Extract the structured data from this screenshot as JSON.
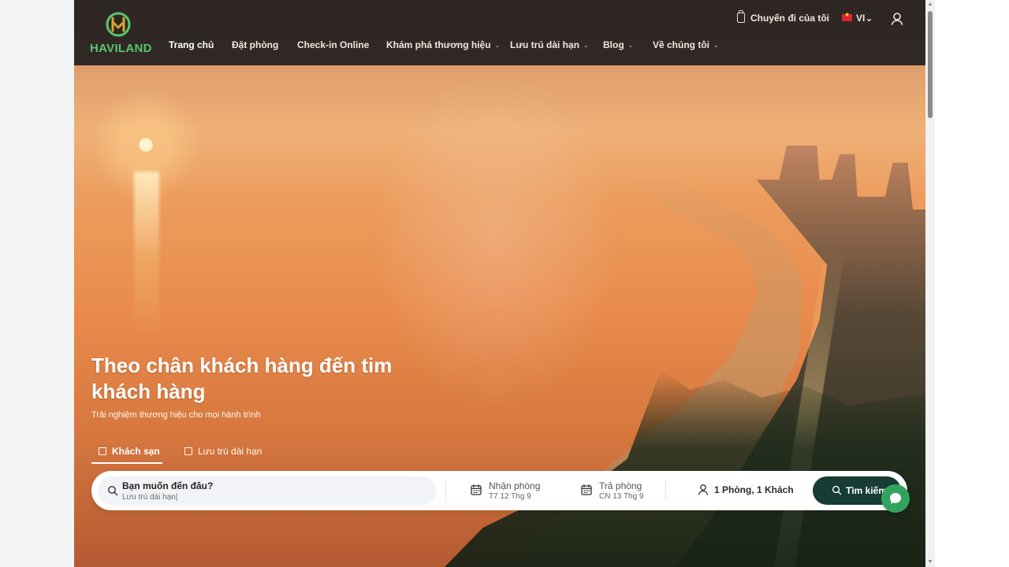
{
  "brand": {
    "name": "HAVILAND",
    "accent": "#58C66F"
  },
  "nav": {
    "items": [
      {
        "label": "Trang chủ"
      },
      {
        "label": "Đặt phòng"
      },
      {
        "label": "Check-in Online"
      },
      {
        "label": "Khám phá thương hiệu"
      },
      {
        "label": "Lưu trú dài hạn"
      },
      {
        "label": "Blog"
      },
      {
        "label": "Về chúng tôi"
      }
    ],
    "trip_label": "Chuyến đi của tôi",
    "language": "VI"
  },
  "hero": {
    "headline": "Theo chân khách hàng đến tim khách hàng",
    "subheadline": "Trải nghiệm thương hiệu cho mọi hành trình"
  },
  "tabs": [
    {
      "label": "Khách sạn"
    },
    {
      "label": "Lưu trú dài hạn"
    }
  ],
  "search": {
    "where_label": "Bạn muốn đến đâu?",
    "where_value": "Lưu trú dài hạn|",
    "checkin_label": "Nhận phòng",
    "checkin_value": "T7 12 Thg 9",
    "checkout_label": "Trả phòng",
    "checkout_value": "CN 13 Thg 9",
    "guests": "1 Phòng, 1 Khách",
    "button": "Tìm kiếm"
  },
  "colors": {
    "button": "#163C34",
    "chat": "#32A35D"
  },
  "icons": {
    "brand": "haviland-logo-icon",
    "trip": "luggage-icon",
    "user": "user-icon",
    "search": "search-icon",
    "calendar": "calendar-icon",
    "person": "person-icon",
    "chat": "chat-icon"
  }
}
